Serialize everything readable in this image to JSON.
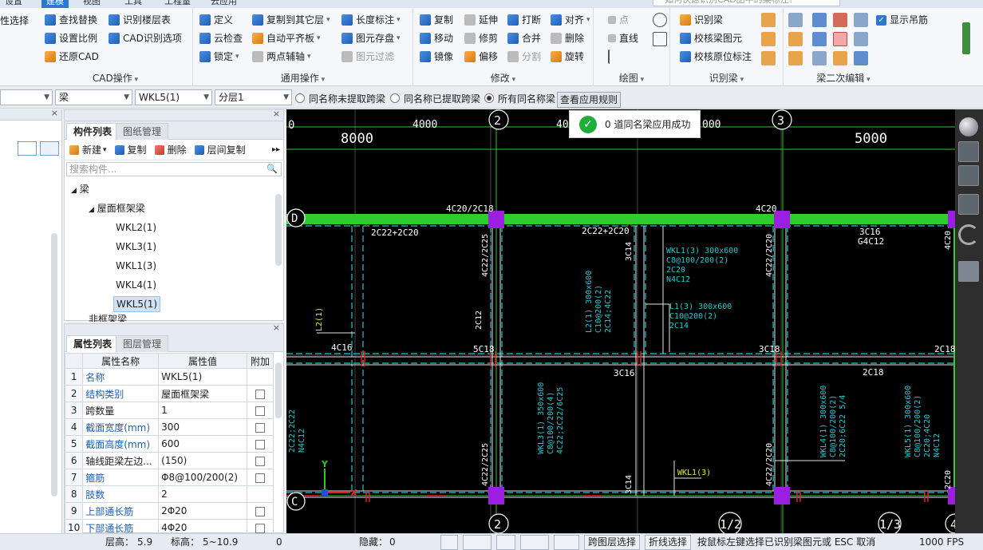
{
  "tabs": {
    "items": [
      "设置",
      "建模",
      "视图",
      "工具",
      "工程量",
      "云应用"
    ],
    "active_index": 1,
    "search_placeholder": "如何快速识别CAD图中的梁标注？"
  },
  "ribbon": {
    "partial_left_label": "性选择",
    "cad_ops": {
      "title": "CAD操作",
      "find_replace": "查找替换",
      "recognize_floor_table": "识别楼层表",
      "set_scale": "设置比例",
      "cad_recognize_options": "CAD识别选项",
      "restore_cad": "还原CAD"
    },
    "common_ops": {
      "title": "通用操作",
      "define": "定义",
      "copy_to_other_floors": "复制到其它层",
      "length_dimension": "长度标注",
      "cloud_check": "云检查",
      "auto_flat_slab": "自动平齐板",
      "save_element": "图元存盘",
      "lock": "锁定",
      "two_point_axis": "两点辅轴",
      "element_filter": "图元过滤"
    },
    "modify": {
      "title": "修改",
      "copy": "复制",
      "extend": "延伸",
      "break": "打断",
      "align": "对齐",
      "move": "移动",
      "trim": "修剪",
      "merge": "合并",
      "delete": "删除",
      "mirror": "镜像",
      "offset": "偏移",
      "split": "分割",
      "rotate": "旋转"
    },
    "draw": {
      "title": "绘图",
      "point": "点",
      "line": "直线"
    },
    "recognize_beam": {
      "title": "识别梁",
      "recognize_beam": "识别梁",
      "check_beam_element": "校核梁图元",
      "check_original_annotation": "校核原位标注"
    },
    "beam_edit": {
      "title": "梁二次编辑",
      "show_hanger_bar": "显示吊筋"
    }
  },
  "filterbar": {
    "combo1": "",
    "combo2": "梁",
    "combo3": "WKL5(1)",
    "combo4": "分层1",
    "radio1": "同名称未提取跨梁",
    "radio2": "同名称已提取跨梁",
    "radio3": "所有同名称梁",
    "radio_selected": 3,
    "apply_rules_button": "查看应用规则"
  },
  "toast": {
    "message": "0 道同名梁应用成功"
  },
  "component_list": {
    "tab_active": "构件列表",
    "tab_other": "图纸管理",
    "new_label": "新建",
    "copy_label": "复制",
    "delete_label": "删除",
    "floor_copy_label": "层间复制",
    "search_placeholder": "搜索构件...",
    "tree": {
      "root": "梁",
      "group": "屋面框架梁",
      "items": [
        "WKL2(1)",
        "WKL3(1)",
        "WKL1(3)",
        "WKL4(1)",
        "WKL5(1)"
      ],
      "selected": "WKL5(1)",
      "partial_next": "非框架梁"
    }
  },
  "properties": {
    "tab_active": "属性列表",
    "tab_other": "图层管理",
    "headers": [
      "属性名称",
      "属性值",
      "附加"
    ],
    "rows": [
      {
        "n": "1",
        "name": "名称",
        "value": "WKL5(1)",
        "blue": true,
        "check": false
      },
      {
        "n": "2",
        "name": "结构类别",
        "value": "屋面框架梁",
        "blue": true,
        "check": true
      },
      {
        "n": "3",
        "name": "跨数量",
        "value": "1",
        "blue": false,
        "check": true
      },
      {
        "n": "4",
        "name": "截面宽度(mm)",
        "value": "300",
        "blue": true,
        "check": true
      },
      {
        "n": "5",
        "name": "截面高度(mm)",
        "value": "600",
        "blue": true,
        "check": true
      },
      {
        "n": "6",
        "name": "轴线距梁左边...",
        "value": "(150)",
        "blue": false,
        "check": true
      },
      {
        "n": "7",
        "name": "箍筋",
        "value": "Φ8@100/200(2)",
        "blue": true,
        "check": true
      },
      {
        "n": "8",
        "name": "肢数",
        "value": "2",
        "blue": true,
        "check": false
      },
      {
        "n": "9",
        "name": "上部通长筋",
        "value": "2Φ20",
        "blue": true,
        "check": true
      },
      {
        "n": "10",
        "name": "下部通长筋",
        "value": "4Φ20",
        "blue": true,
        "check": true
      }
    ]
  },
  "canvas": {
    "top_dims": [
      "0",
      "4000",
      "400",
      "8000",
      "000",
      "5000"
    ],
    "top_dims_large": [
      "8000",
      "5000"
    ],
    "axis_top": [
      "2",
      "3"
    ],
    "axis_bottom": [
      "2",
      "1/2",
      "1/3",
      "4"
    ],
    "axis_left": [
      "D",
      "C"
    ],
    "axis_right": [
      "C"
    ],
    "beam_labels": {
      "d_4c20_2c18": "4C20/2C18",
      "d_4c20": "4C20",
      "d_2c22_2c20_a": "2C22+2C20",
      "d_2c22_2c20_b": "2C22+2C20",
      "d_3c16": "3C16",
      "d_g4c12": "G4C12",
      "v_4c22_2c25_top": "4C22/2C25",
      "v_3c14": "3C14",
      "v_4c22_2c20_top": "4C22/2C20",
      "v_4c20_right": "4C20",
      "wkl1_block": [
        "WKL1(3) 300x600",
        "C8@100/200(2)",
        "2C20",
        "N4C12"
      ],
      "l1_block": [
        "L1(3) 300x600",
        "C10@200(2)",
        "2C14"
      ],
      "l2_block": [
        "L2(1) 300x600",
        "C10@200(2)",
        "2C14;4C22"
      ],
      "l2_1": "L2(1)",
      "c_2c12": "2C12",
      "c_5c18": "5C18",
      "c_4c16": "4C16",
      "c_3c16": "3C16",
      "c_3c18": "3C18",
      "c_2c18_a": "2C18",
      "c_2c18_b": "2C18",
      "wkl3_block": [
        "WKL3(1) 350x600",
        "C8@100/200(4)",
        "4C22;2C22/6C25"
      ],
      "wkl4_block": [
        "WKL4(1) 300x600",
        "C8@100/200(2)",
        "2C20;6C22 5/4"
      ],
      "wkl5_block": [
        "WKL5(1) 300x600",
        "C8@100/200(2)",
        "2C20;4C20",
        "N4C12"
      ],
      "left_partial": [
        "2C22;2C22",
        "N4C12"
      ],
      "v_4c22_2c25_bot": "4C22/2C25",
      "v_3c14_bot": "3C14",
      "v_4c22_2c20_bot": "4C22/2C20",
      "v_2c20_bot": "2C20",
      "wkl1_callout": "WKL1(3)"
    },
    "ucs": {
      "x": "X",
      "y": "Y"
    }
  },
  "statusbar": {
    "floor_height_label": "层高：",
    "floor_height": "5.9",
    "elevation_label": "标高：",
    "elevation": "5~10.9",
    "zero": "0",
    "hidden_label": "隐藏：",
    "hidden": "0",
    "cross_layer_select": "跨图层选择",
    "polyline_select": "折线选择",
    "hint": "按鼠标左键选择已识别梁图元或 ESC 取消",
    "fps": "1000 FPS"
  },
  "colors": {
    "accent": "#2b78d4",
    "beam_green": "#2ecc2e",
    "column_purple": "#9b1fe0",
    "cad_cyan": "#20c8d0",
    "cad_red": "#e02020",
    "success": "#1fae3a"
  }
}
